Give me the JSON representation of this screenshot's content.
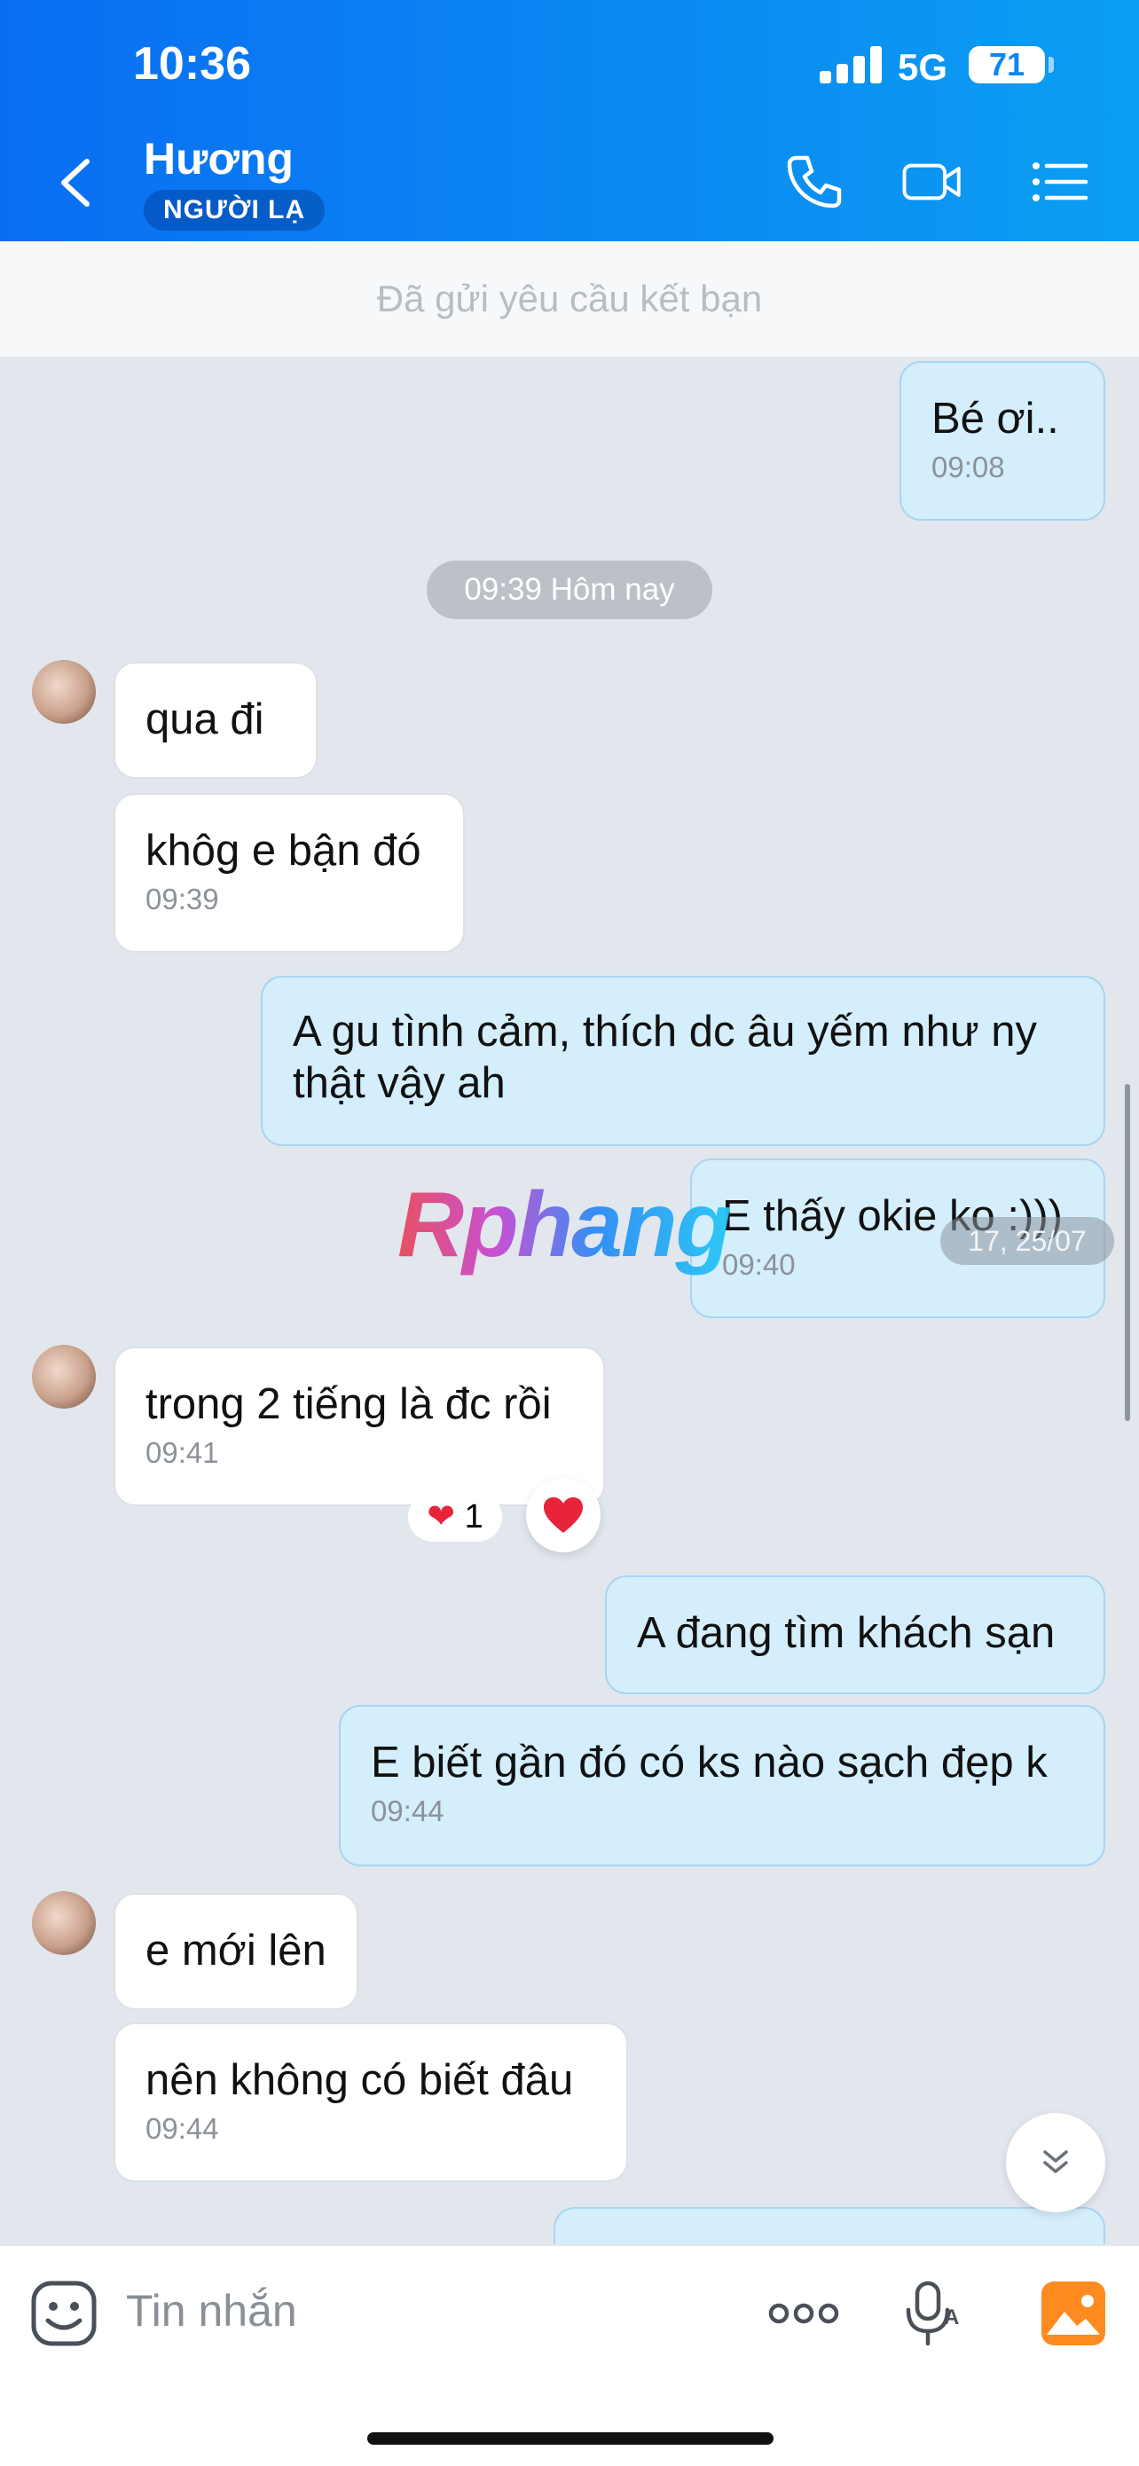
{
  "status_bar": {
    "time": "10:36",
    "network": "5G",
    "battery": "71"
  },
  "header": {
    "contact_name": "Hương",
    "badge": "NGƯỜI LẠ"
  },
  "banner": {
    "text": "Đã gửi yêu cầu kết bạn"
  },
  "messages": [
    {
      "text": "Bé ơi..",
      "time": "09:08"
    },
    {
      "date_separator": "09:39 Hôm nay"
    },
    {
      "text": "qua đi"
    },
    {
      "text": "khôg e bận đó",
      "time": "09:39"
    },
    {
      "text": "A gu tình cảm, thích dc âu yếm như ny thật vậy ah"
    },
    {
      "text": "E thấy okie ko :)))",
      "time": "09:40"
    },
    {
      "text": "trong 2 tiếng là đc rồi",
      "time": "09:41"
    },
    {
      "text": "A đang tìm khách sạn"
    },
    {
      "text": "E biết gần đó có ks nào sạch đẹp k",
      "time": "09:44"
    },
    {
      "text": "e mới lên"
    },
    {
      "text": "nên không có biết đâu",
      "time": "09:44"
    }
  ],
  "reaction": {
    "count": "1"
  },
  "overlay": {
    "date": "17, 25/07",
    "watermark": "Rphang"
  },
  "composer": {
    "placeholder": "Tin nhắn"
  },
  "colors": {
    "header_start": "#0a6ef2",
    "header_end": "#0b9ef2",
    "outgoing_bubble": "#d4eefc",
    "incoming_bubble": "#ffffff",
    "chat_bg": "#e2e7ee"
  }
}
